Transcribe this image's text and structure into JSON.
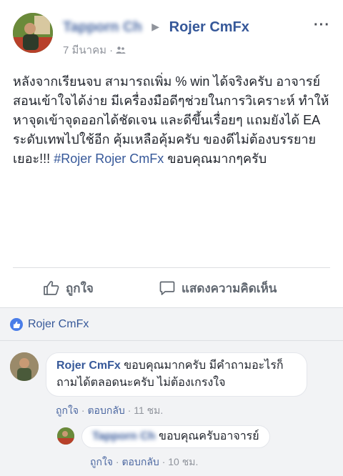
{
  "post": {
    "author_blurred": "Tapporn Ch",
    "target_page": "Rojer CmFx",
    "date": "7 มีนาคม",
    "privacy_separator": "·",
    "privacy_icon": "friends-icon",
    "more_label": "···",
    "text": "หลังจากเรียนจบ สามารถเพิ่ม % win ได้จริงครับ อาจารย์สอนเข้าใจได้ง่าย มีเครื่องมือดีๆช่วยในการวิเคราะห์ ทำให้หาจุดเข้าจุดออกได้ชัดเจน และดีขึ้นเรื่อยๆ แถมยังได้ EA ระดับเทพไปใช้อีก คุ้มเหลือคุ้มครับ ของดีไม่ต้องบรรยายเยอะ!!! ",
    "hashtag": "#Rojer Rojer CmFx",
    "text_tail": " ขอบคุณมากๆครับ"
  },
  "actions": {
    "like_label": "ถูกใจ",
    "comment_label": "แสดงความคิดเห็น"
  },
  "likes": {
    "liker": "Rojer CmFx"
  },
  "comments": [
    {
      "author": "Rojer CmFx",
      "text": " ขอบคุณมากครับ มีคำถามอะไรก็ถามได้ตลอดนะครับ ไม่ต้องเกรงใจ",
      "like": "ถูกใจ",
      "reply": "ตอบกลับ",
      "time": "11 ชม."
    },
    {
      "author_blurred": "Tapporn Ch",
      "text": " ขอบคุณครับอาจารย์",
      "like": "ถูกใจ",
      "reply": "ตอบกลับ",
      "time": "10 ชม."
    }
  ],
  "colors": {
    "link": "#365899",
    "muted": "#90949c",
    "comment_bg": "#f2f3f5",
    "like_blue": "#4a7de8"
  }
}
